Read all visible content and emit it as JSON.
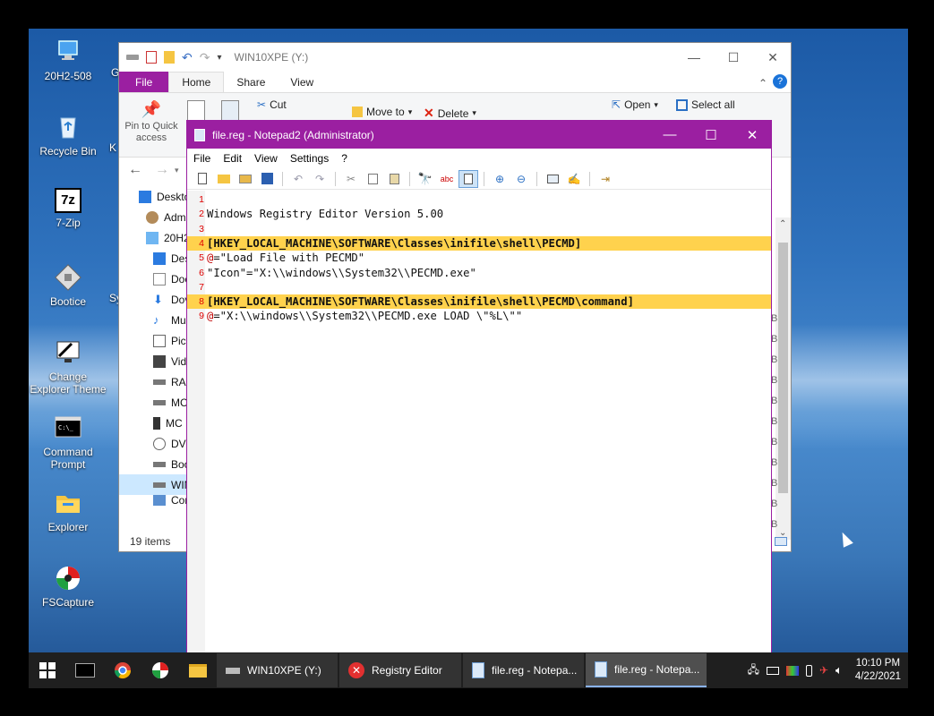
{
  "desktop": {
    "icons": [
      {
        "label": "20H2-508",
        "icon": "monitor-icon"
      },
      {
        "label": "Recycle Bin",
        "icon": "recycle-bin-icon"
      },
      {
        "label": "7-Zip",
        "icon": "7zip-icon",
        "glyph": "7z"
      },
      {
        "label": "Bootice",
        "icon": "bootice-icon"
      },
      {
        "label": "Change Explorer Theme",
        "icon": "theme-icon"
      },
      {
        "label": "Command Prompt",
        "icon": "cmd-icon"
      },
      {
        "label": "Explorer",
        "icon": "folder-icon"
      },
      {
        "label": "FSCapture",
        "icon": "fscapture-icon"
      }
    ],
    "partial_labels": [
      "G",
      "K",
      "Sy"
    ]
  },
  "explorer": {
    "title": "WIN10XPE (Y:)",
    "tabs": [
      "File",
      "Home",
      "Share",
      "View"
    ],
    "ribbon": {
      "pin": "Pin to Quick access",
      "cut": "Cut",
      "move_to": "Move to",
      "delete": "Delete",
      "open": "Open",
      "select_all": "Select all"
    },
    "nav_items": [
      "Deskto",
      "Adm",
      "20H2",
      "Des",
      "Doc",
      "Dov",
      "Mu",
      "Pict",
      "Vide",
      "RAM",
      "MC",
      "MC",
      "DVD",
      "Boo",
      "WIN",
      "Cont"
    ],
    "status": "19 items",
    "right_column": [
      "B",
      "B",
      "B",
      "B",
      "B",
      "B",
      "B",
      "B",
      "B",
      "B",
      "B"
    ]
  },
  "notepad": {
    "title": "file.reg - Notepad2 (Administrator)",
    "menu": [
      "File",
      "Edit",
      "View",
      "Settings",
      "?"
    ],
    "lines": [
      {
        "n": "1",
        "text": "",
        "highlight": false
      },
      {
        "n": "2",
        "text": "Windows Registry Editor Version 5.00",
        "highlight": false
      },
      {
        "n": "3",
        "text": "",
        "highlight": false
      },
      {
        "n": "4",
        "text": "[HKEY_LOCAL_MACHINE\\SOFTWARE\\Classes\\inifile\\shell\\PECMD]",
        "highlight": true
      },
      {
        "n": "5",
        "at": "@",
        "text": "=\"Load File with PECMD\"",
        "highlight": false
      },
      {
        "n": "6",
        "text": "\"Icon\"=\"X:\\\\windows\\\\System32\\\\PECMD.exe\"",
        "highlight": false
      },
      {
        "n": "7",
        "text": "",
        "highlight": false
      },
      {
        "n": "8",
        "text": "[HKEY_LOCAL_MACHINE\\SOFTWARE\\Classes\\inifile\\shell\\PECMD\\command]",
        "highlight": true
      },
      {
        "n": "9",
        "at": "@",
        "text": "=\"X:\\\\windows\\\\System32\\\\PECMD.exe LOAD \\\"%L\\\"\"",
        "highlight": false
      }
    ]
  },
  "taskbar": {
    "buttons": [
      {
        "label": "WIN10XPE (Y:)",
        "icon": "drive-icon",
        "active": false
      },
      {
        "label": "Registry Editor",
        "icon": "error-icon",
        "active": false
      },
      {
        "label": "file.reg - Notepa...",
        "icon": "notepad-icon",
        "active": false
      },
      {
        "label": "file.reg - Notepa...",
        "icon": "notepad-icon",
        "active": true
      }
    ],
    "clock_time": "10:10 PM",
    "clock_date": "4/22/2021"
  },
  "colors": {
    "accent": "#9b1fa1",
    "highlight": "#ffd24d",
    "line_number": "#e00000"
  }
}
